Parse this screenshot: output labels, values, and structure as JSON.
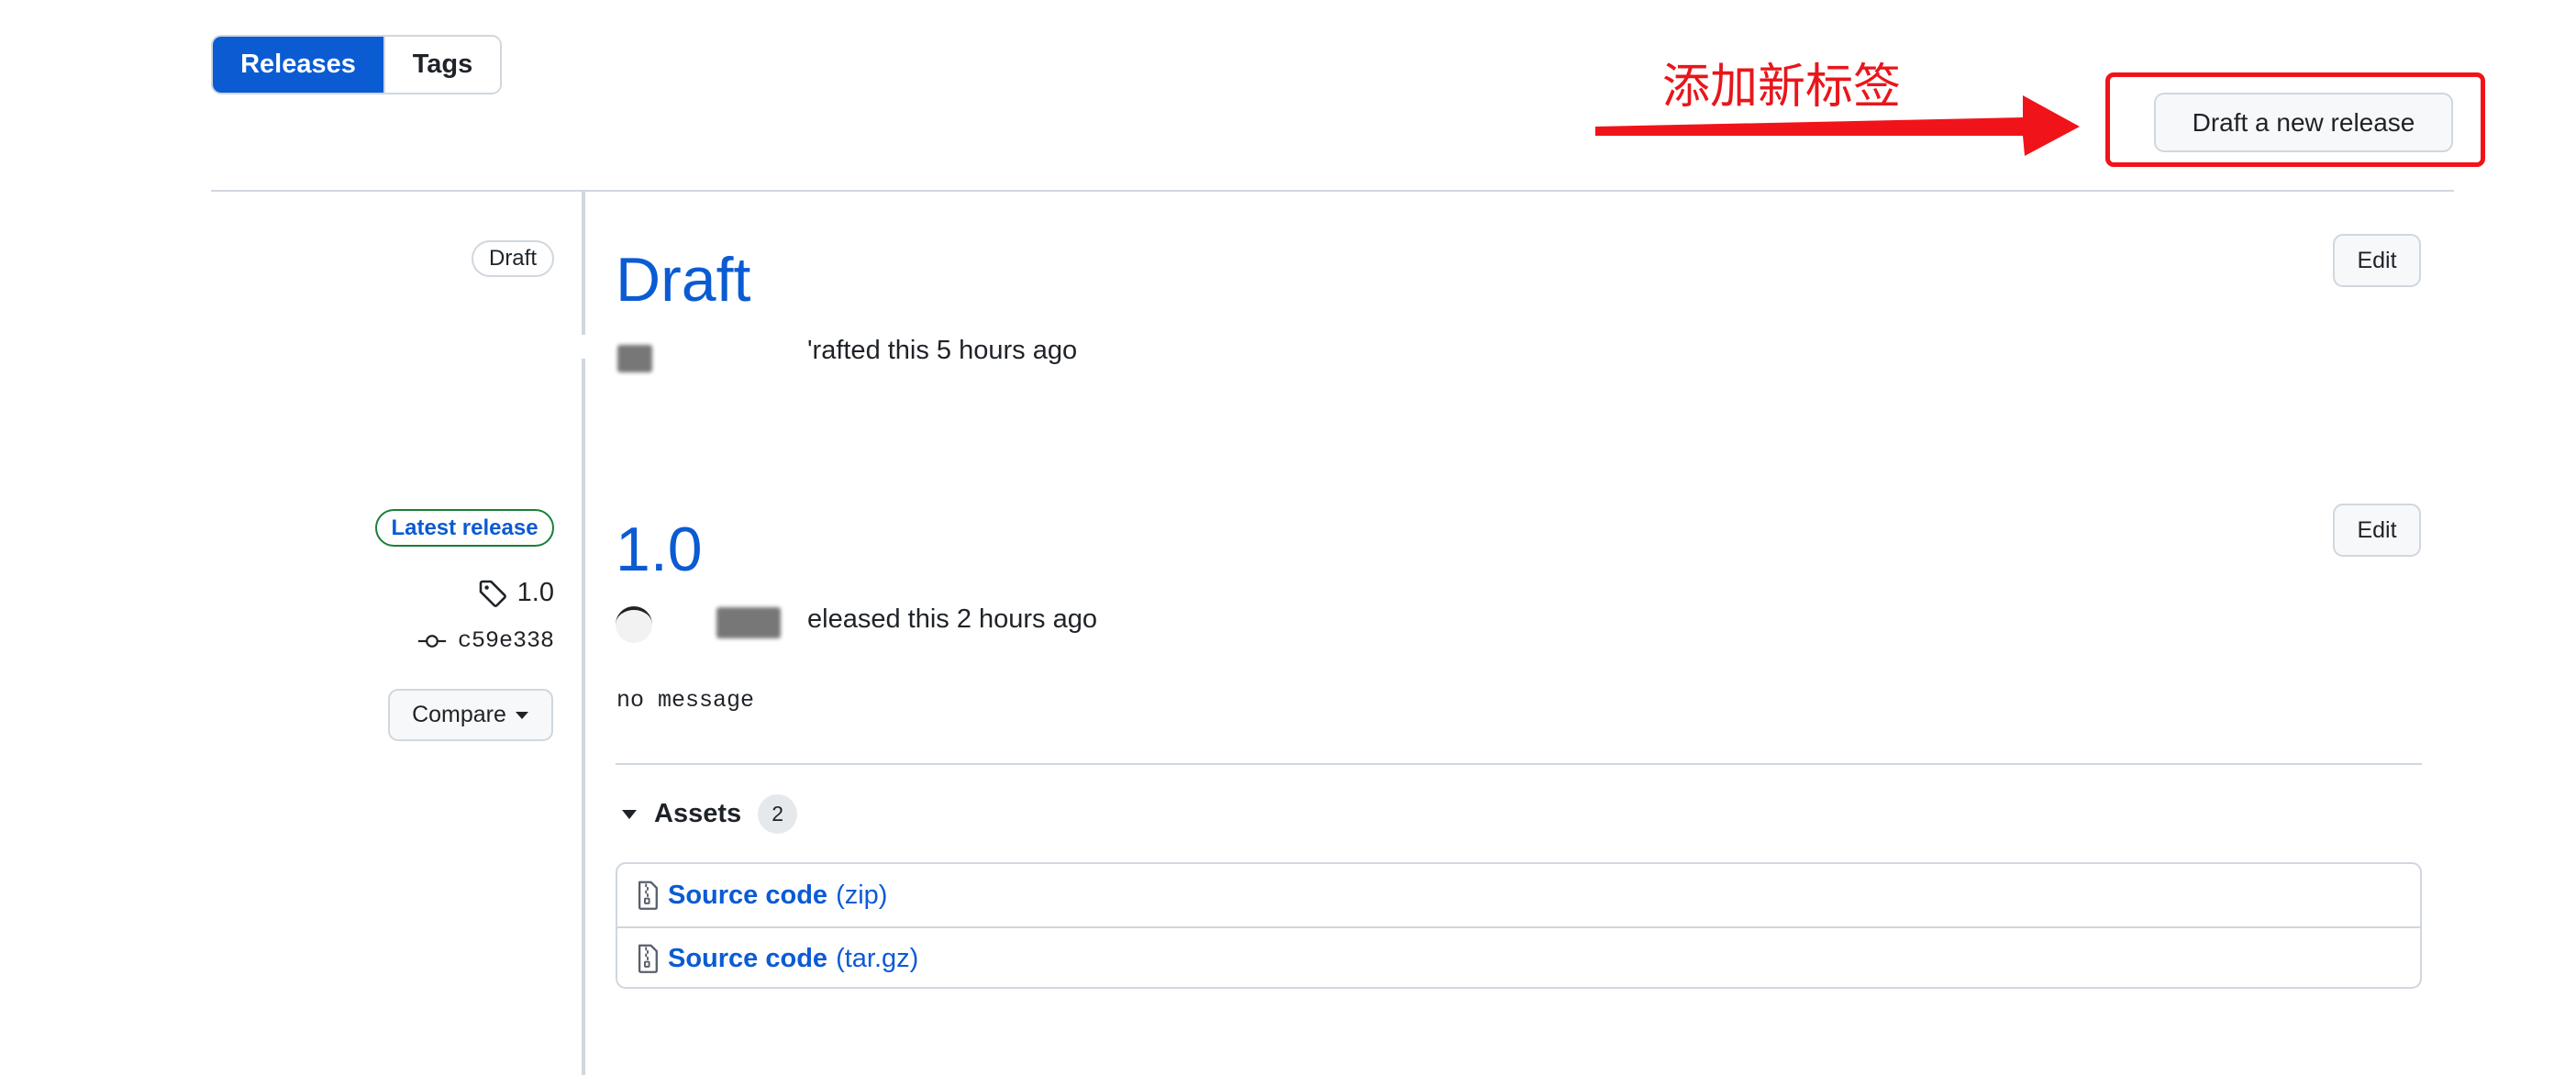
{
  "tabs": [
    {
      "label": "Releases",
      "active": true
    },
    {
      "label": "Tags",
      "active": false
    }
  ],
  "annotation": {
    "text": "添加新标签",
    "color": "#e8161b"
  },
  "header": {
    "draft_new_release_label": "Draft a new release"
  },
  "releases": [
    {
      "badge": "Draft",
      "title": "Draft",
      "meta": "'rafted this 5 hours ago",
      "edit_label": "Edit"
    },
    {
      "badge": "Latest release",
      "tag": "1.0",
      "commit": "c59e338",
      "compare_label": "Compare",
      "title": "1.0",
      "meta": "eleased this 2 hours ago",
      "edit_label": "Edit",
      "message": "no message",
      "assets_label": "Assets",
      "assets_count": "2",
      "assets": [
        {
          "name": "Source code",
          "ext": "(zip)"
        },
        {
          "name": "Source code",
          "ext": "(tar.gz)"
        }
      ]
    }
  ],
  "colors": {
    "accent": "#0b5bd3",
    "latest_border": "#1a7f37",
    "annotation": "#e8161b"
  }
}
